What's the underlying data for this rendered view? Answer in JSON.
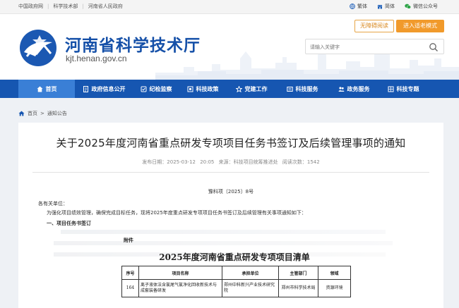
{
  "topbar": {
    "links": [
      "中国政府网",
      "科学技术部",
      "河南省人民政府"
    ],
    "tools": [
      {
        "label": "繁体",
        "icon": "globe-icon",
        "color": "#1f5fb8"
      },
      {
        "label": "简体",
        "icon": "building-icon",
        "color": "#1f5fb8"
      },
      {
        "label": "微信公众号",
        "icon": "wechat-icon",
        "color": "#2ba245"
      }
    ]
  },
  "header": {
    "title": "河南省科学技术厅",
    "url": "kjt.henan.gov.cn",
    "btn_nobar": "无障碍阅读",
    "btn_elder": "进入适老模式",
    "search_placeholder": "请输入关键字"
  },
  "nav": {
    "items": [
      {
        "label": "首页",
        "icon": "home-icon"
      },
      {
        "label": "政府信息公开",
        "icon": "document-icon"
      },
      {
        "label": "纪检监察",
        "icon": "inspect-icon"
      },
      {
        "label": "科技政策",
        "icon": "policy-icon"
      },
      {
        "label": "党建工作",
        "icon": "star-icon"
      },
      {
        "label": "科技服务",
        "icon": "service-icon"
      },
      {
        "label": "政务服务",
        "icon": "people-icon"
      },
      {
        "label": "科技专题",
        "icon": "topic-icon"
      }
    ],
    "active_index": 0,
    "color": "#1656b1"
  },
  "breadcrumb": {
    "home": "首页",
    "sep": ">",
    "current": "通知公告"
  },
  "article": {
    "title": "关于2025年度河南省重点研发专项项目任务书签订及后续管理事项的通知",
    "meta_date": "发布日期：2025-03-12 20:05",
    "meta_source": "来源：科技项目统筹推进处",
    "meta_views": "阅读次数：1542",
    "doc_number": "豫科项〔2025〕8号",
    "salutation": "各有关单位：",
    "intro": "为强化项目绩效管理，确保完成目标任务，现将2025年度重点研发专项项目任务书签订及后续管理有关事项通知如下：",
    "section1": "一、项目任务书签订",
    "attachment_label": "附件",
    "list_title": "2025年度河南省重点研发专项项目清单"
  },
  "table": {
    "headers": [
      "序号",
      "项目名称",
      "承担单位",
      "主管部门",
      "领域"
    ],
    "rows": [
      [
        "164",
        "离子液体法含氯尾气氯净化回收新技术与成套装备研发",
        "郑州中科新兴产业技术研究院",
        "郑州市科学技术局",
        "资源环境"
      ]
    ]
  }
}
